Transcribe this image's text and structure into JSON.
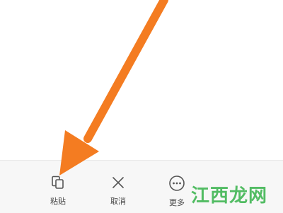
{
  "toolbar": {
    "paste_label": "粘贴",
    "cancel_label": "取消",
    "more_label": "更多",
    "paste_icon": "copy-icon",
    "cancel_icon": "close-icon",
    "more_icon": "more-icon"
  },
  "watermark": {
    "text": "江西龙网"
  },
  "colors": {
    "arrow": "#f47c21",
    "watermark": "#36b24a",
    "toolbar_bg": "#f7f7f7"
  }
}
